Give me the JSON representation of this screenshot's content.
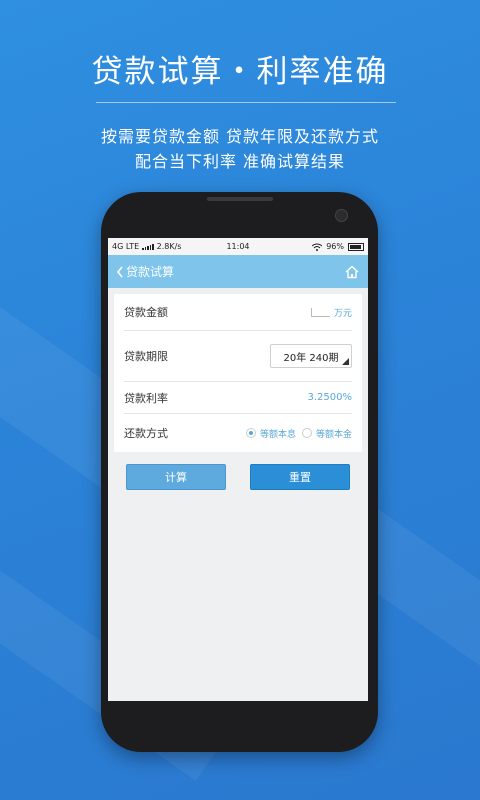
{
  "promo": {
    "headline": "贷款试算・利率准确",
    "line1": "按需要贷款金额  贷款年限及还款方式",
    "line2": "配合当下利率  准确试算结果"
  },
  "status_bar": {
    "network": "4G LTE",
    "speed": "2.8K/s",
    "time": "11:04",
    "battery": "96%"
  },
  "app": {
    "title": "贷款试算",
    "back_icon": "chevron-left-icon",
    "home_icon": "home-icon",
    "header_color": "#7fc4ea"
  },
  "form": {
    "amount_label": "贷款金额",
    "amount_value": "",
    "amount_unit": "万元",
    "period_label": "贷款期限",
    "period_value": "20年  240期",
    "rate_label": "贷款利率",
    "rate_value": "3.2500%",
    "repay_label": "还款方式",
    "repay_options": [
      "等额本息",
      "等额本金"
    ],
    "repay_selected": "等额本息"
  },
  "buttons": {
    "calculate": "计算",
    "reset": "重置"
  },
  "colors": {
    "background": "#2b83d8",
    "accent": "#5aa8d8",
    "reset_button": "#2a8fd6"
  }
}
